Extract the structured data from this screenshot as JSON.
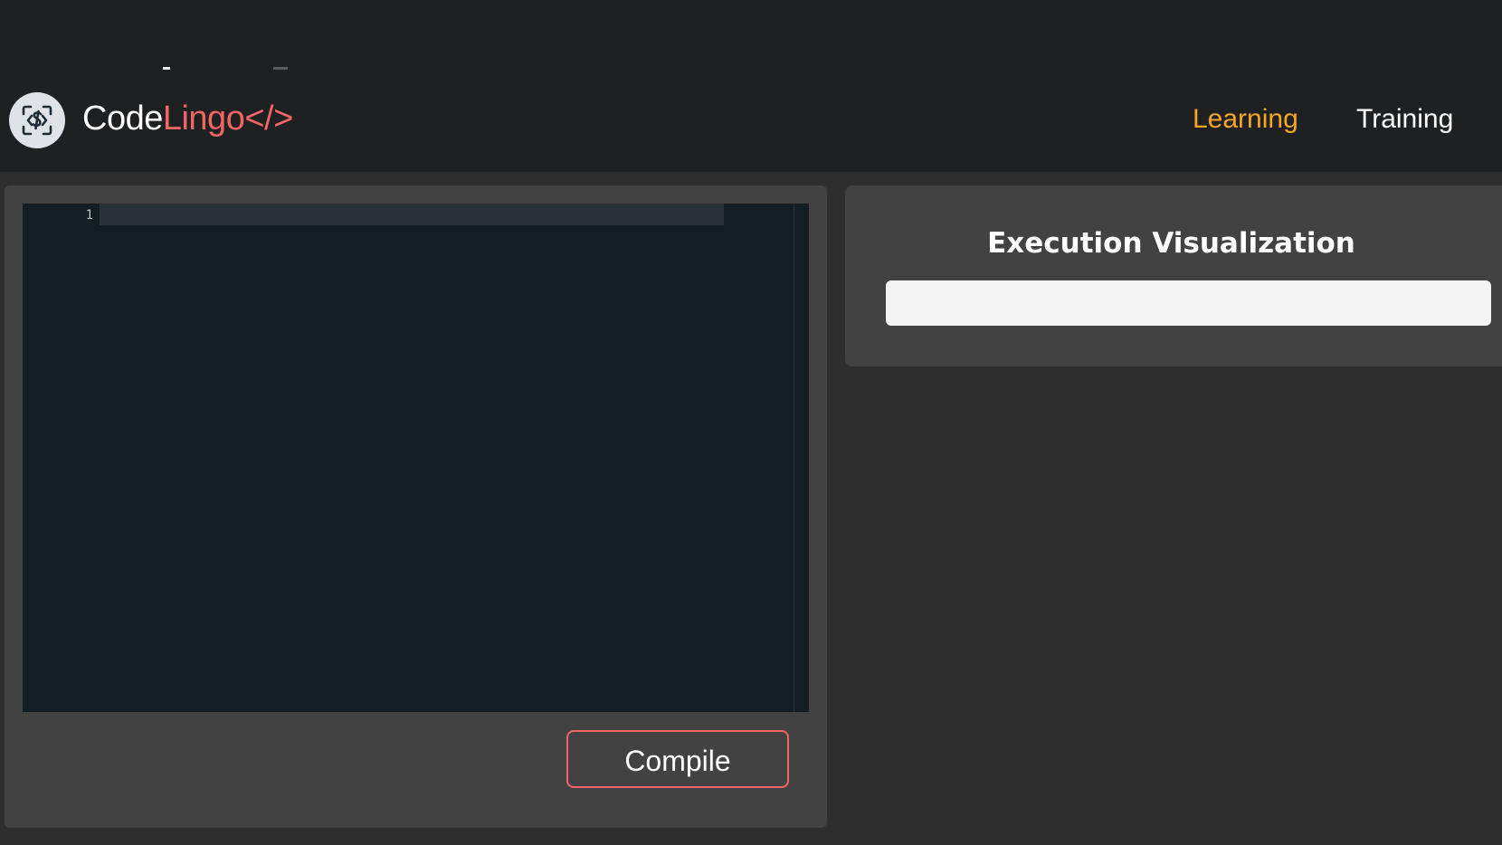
{
  "brand": {
    "name_prefix": "Code",
    "name_accent": "Lingo</>",
    "logo_icon": "code-scan-icon"
  },
  "nav": {
    "items": [
      {
        "label": "Learning",
        "active": true,
        "color": "#f5a623"
      },
      {
        "label": "Training",
        "active": false,
        "color": "#ffffff"
      }
    ]
  },
  "editor": {
    "line_numbers": [
      "1"
    ],
    "content": ""
  },
  "actions": {
    "compile_label": "Compile"
  },
  "visualization": {
    "title": "Execution Visualization",
    "output": ""
  },
  "colors": {
    "accent_red": "#f26565",
    "accent_orange": "#f5a623",
    "header_bg": "#1f2021",
    "page_bg": "#2e2e2e",
    "panel_bg": "#424242",
    "editor_bg": "#121e23"
  }
}
